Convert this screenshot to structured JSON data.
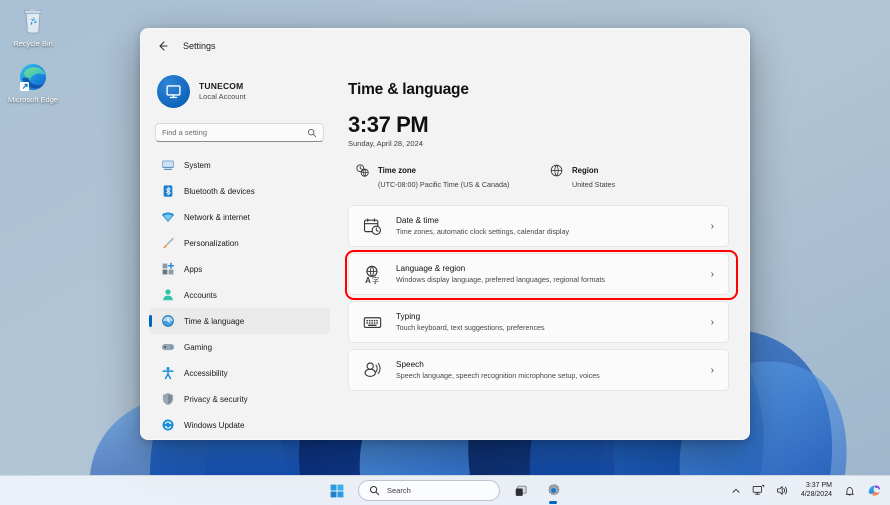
{
  "desktop": {
    "icons": [
      {
        "name": "recycle-bin",
        "label": "Recycle Bin"
      },
      {
        "name": "microsoft-edge",
        "label": "Microsoft Edge"
      }
    ]
  },
  "window": {
    "title": "Settings",
    "back_icon": "arrow-left-icon"
  },
  "account": {
    "name": "TUNECOM",
    "type": "Local Account",
    "avatar_icon": "monitor-icon"
  },
  "search": {
    "placeholder": "Find a setting",
    "value": "",
    "icon": "search-icon"
  },
  "sidebar": {
    "items": [
      {
        "label": "System",
        "icon": "monitor-icon",
        "selected": false
      },
      {
        "label": "Bluetooth & devices",
        "icon": "bluetooth-icon",
        "selected": false
      },
      {
        "label": "Network & internet",
        "icon": "wifi-icon",
        "selected": false
      },
      {
        "label": "Personalization",
        "icon": "paintbrush-icon",
        "selected": false
      },
      {
        "label": "Apps",
        "icon": "apps-grid-icon",
        "selected": false
      },
      {
        "label": "Accounts",
        "icon": "person-icon",
        "selected": false
      },
      {
        "label": "Time & language",
        "icon": "clock-globe-icon",
        "selected": true
      },
      {
        "label": "Gaming",
        "icon": "gamepad-icon",
        "selected": false
      },
      {
        "label": "Accessibility",
        "icon": "accessibility-person-icon",
        "selected": false
      },
      {
        "label": "Privacy & security",
        "icon": "shield-icon",
        "selected": false
      },
      {
        "label": "Windows Update",
        "icon": "update-refresh-icon",
        "selected": false
      }
    ]
  },
  "page": {
    "title": "Time & language",
    "clock_time": "3:37 PM",
    "clock_date": "Sunday, April 28, 2024",
    "meta": [
      {
        "label": "Time zone",
        "value": "(UTC-08:00) Pacific Time (US & Canada)",
        "icon": "clock-globe-icon"
      },
      {
        "label": "Region",
        "value": "United States",
        "icon": "globe-icon"
      }
    ],
    "cards": [
      {
        "title": "Date & time",
        "subtitle": "Time zones, automatic clock settings, calendar display",
        "icon": "calendar-clock-icon",
        "chevron": "›",
        "highlighted": false
      },
      {
        "title": "Language & region",
        "subtitle": "Windows display language, preferred languages, regional formats",
        "icon": "language-globe-icon",
        "chevron": "›",
        "highlighted": true
      },
      {
        "title": "Typing",
        "subtitle": "Touch keyboard, text suggestions, preferences",
        "icon": "keyboard-icon",
        "chevron": "›",
        "highlighted": false
      },
      {
        "title": "Speech",
        "subtitle": "Speech language, speech recognition microphone setup, voices",
        "icon": "speech-icon",
        "chevron": "›",
        "highlighted": false
      }
    ]
  },
  "taskbar": {
    "start_icon": "windows-logo-icon",
    "search": {
      "label": "Search",
      "icon": "search-icon"
    },
    "task_view_icon": "task-view-icon",
    "settings_icon": "gear-icon",
    "tray": {
      "overflow_icon": "chevron-up-icon",
      "network_icon": "network-icon",
      "volume_icon": "volume-icon",
      "time": "3:37 PM",
      "date": "4/28/2024",
      "notification_icon": "notification-bell-icon",
      "copilot_icon": "copilot-icon"
    }
  },
  "colors": {
    "accent": "#0067c0",
    "highlight": "#ff0000",
    "window_bg": "#f3f3f3",
    "card_bg": "#fbfbfb"
  }
}
